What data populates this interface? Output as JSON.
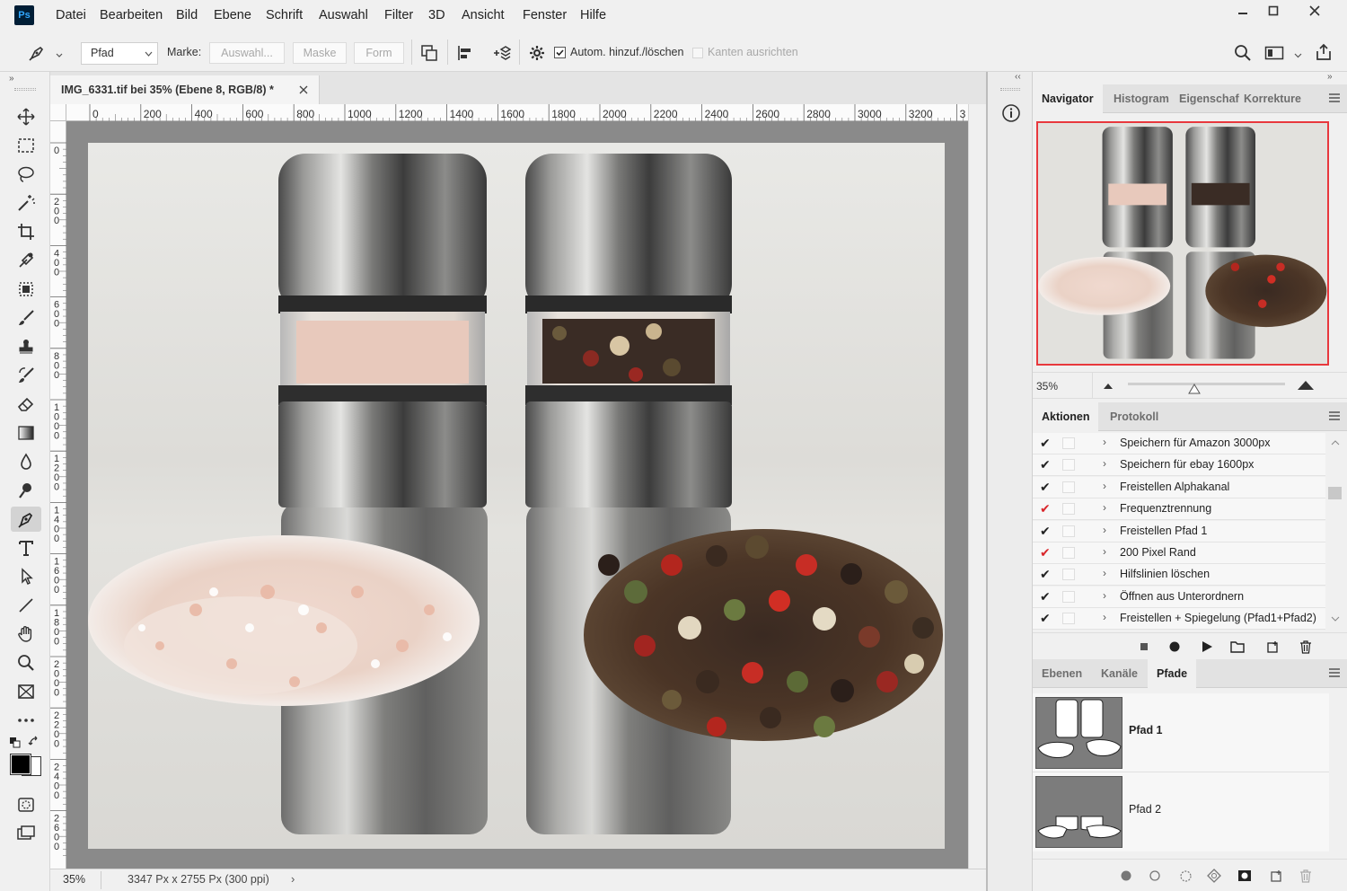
{
  "app": {
    "logo_text": "Ps"
  },
  "menu": [
    "Datei",
    "Bearbeiten",
    "Bild",
    "Ebene",
    "Schrift",
    "Auswahl",
    "Filter",
    "3D",
    "Ansicht",
    "Fenster",
    "Hilfe"
  ],
  "options_bar": {
    "tool_mode": "Pfad",
    "make_label": "Marke:",
    "btn_selection": "Auswahl...",
    "btn_mask": "Maske",
    "btn_shape": "Form",
    "auto_add_delete": "Autom. hinzuf./löschen",
    "align_edges": "Kanten ausrichten"
  },
  "document": {
    "tab_title": "IMG_6331.tif bei 35% (Ebene 8, RGB/8) *",
    "ruler_h_labels": [
      "0",
      "200",
      "400",
      "600",
      "800",
      "1000",
      "1200",
      "1400",
      "1600",
      "1800",
      "2000",
      "2200",
      "2400",
      "2600",
      "2800",
      "3000",
      "3200",
      "3"
    ],
    "ruler_v_labels": [
      "0",
      "2 0 0",
      "4 0 0",
      "6 0 0",
      "8 0 0",
      "1 0 0 0",
      "1 2 0 0",
      "1 4 0 0",
      "1 6 0 0",
      "1 8 0 0",
      "2 0 0 0",
      "2 2 0 0",
      "2 4 0 0",
      "2 6 0 0"
    ],
    "zoom": "35%",
    "info": "3347 Px x 2755 Px (300 ppi)"
  },
  "navigator": {
    "tabs": [
      "Navigator",
      "Histogram",
      "Eigenschaf",
      "Korrekture"
    ],
    "zoom": "35%",
    "zoom_level_fraction": 0.42
  },
  "actions_panel": {
    "tabs": [
      "Aktionen",
      "Protokoll"
    ],
    "items": [
      {
        "label": "Speichern für Amazon 3000px",
        "check_color": "#222222"
      },
      {
        "label": "Speichern für ebay 1600px",
        "check_color": "#222222"
      },
      {
        "label": "Freistellen Alphakanal",
        "check_color": "#222222"
      },
      {
        "label": "Frequenztrennung",
        "check_color": "#d9262b"
      },
      {
        "label": "Freistellen Pfad 1",
        "check_color": "#222222"
      },
      {
        "label": "200 Pixel Rand",
        "check_color": "#d9262b"
      },
      {
        "label": "Hilfslinien löschen",
        "check_color": "#222222"
      },
      {
        "label": "Öffnen aus Unterordnern",
        "check_color": "#222222"
      },
      {
        "label": "Freistellen + Spiegelung (Pfad1+Pfad2)",
        "check_color": "#222222"
      }
    ]
  },
  "layers_panel": {
    "tabs": [
      "Ebenen",
      "Kanäle",
      "Pfade"
    ],
    "paths": [
      {
        "name": "Pfad 1"
      },
      {
        "name": "Pfad 2"
      }
    ]
  },
  "colors": {
    "accent_red": "#e8383d",
    "panel_bg": "#f0f0f0"
  }
}
